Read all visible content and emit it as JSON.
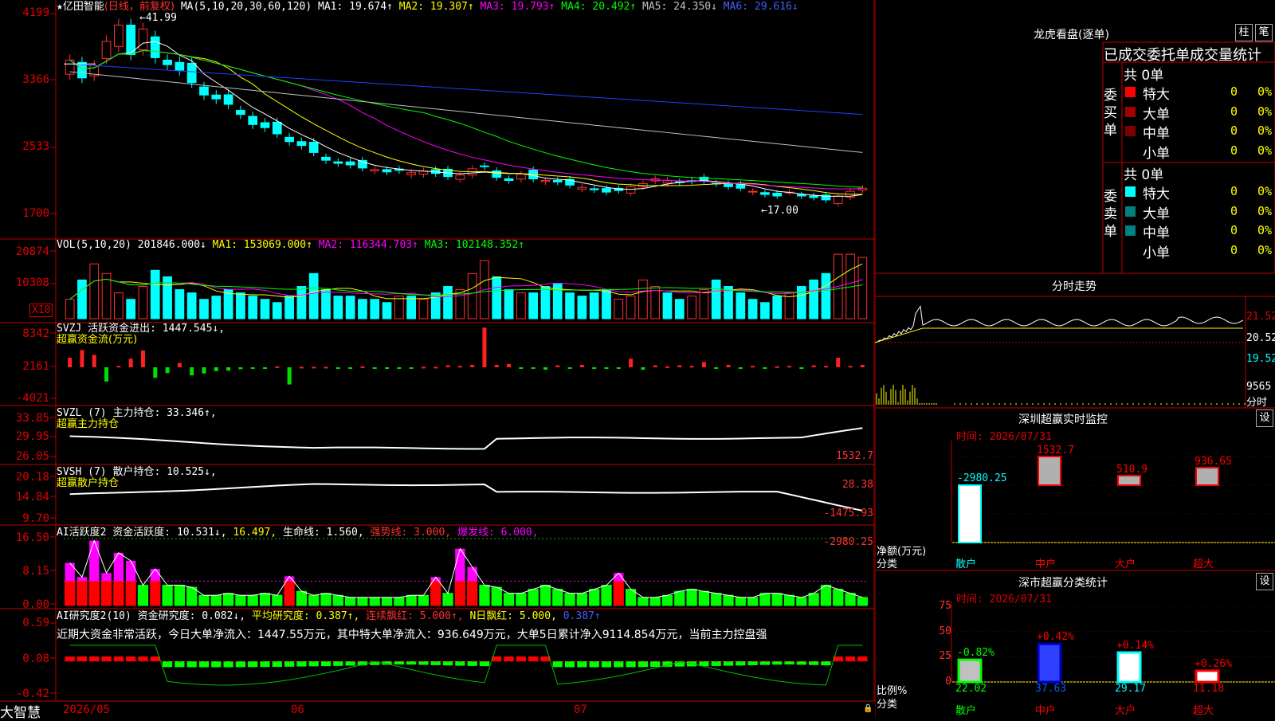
{
  "stock": {
    "star": "★",
    "name": "亿田智能",
    "period": "(日线，前复权)"
  },
  "main": {
    "ma_header": "MA(5,10,20,30,60,120)",
    "ma_items": [
      {
        "label": "MA1: 19.674↑",
        "color": "#ffffff"
      },
      {
        "label": "MA2: 19.307↑",
        "color": "#ffff00"
      },
      {
        "label": "MA3: 19.793↑",
        "color": "#ff00ff"
      },
      {
        "label": "MA4: 20.492↑",
        "color": "#00ff00"
      },
      {
        "label": "MA5: 24.350↓",
        "color": "#c0c0c0"
      },
      {
        "label": "MA6: 29.616↓",
        "color": "#4060ff"
      }
    ],
    "yaxis": [
      "4199",
      "3366",
      "2533",
      "1700"
    ],
    "high_label": "41.99",
    "low_label": "17.00"
  },
  "vol": {
    "header": "VOL(5,10,20)",
    "items": [
      {
        "label": "201846.000↓",
        "color": "#ffffff"
      },
      {
        "label": "MA1: 153069.000↑",
        "color": "#ffff00"
      },
      {
        "label": "MA2: 116344.703↑",
        "color": "#ff00ff"
      },
      {
        "label": "MA3: 102148.352↑",
        "color": "#00ff00"
      }
    ],
    "yaxis": [
      "20874",
      "10308"
    ],
    "unit": "X10"
  },
  "svzj": {
    "header": "SVZJ  活跃资金进出: 1447.545↓,",
    "sub": "超赢资金流(万元)",
    "yaxis": [
      "8342",
      "2161",
      "-4021"
    ]
  },
  "svzl": {
    "header": "SVZL (7) 主力持仓: 33.346↑,",
    "sub": "超赢主力持仓",
    "yaxis": [
      "33.85",
      "29.95",
      "26.05"
    ]
  },
  "svsh": {
    "header": "SVSH (7) 散户持仓: 10.525↓,",
    "sub": "超赢散户持仓",
    "yaxis": [
      "20.18",
      "14.84",
      "9.70"
    ]
  },
  "ai1": {
    "items": [
      {
        "label": "AI活跃度2 资金活跃度: 10.531↓,",
        "color": "#ffffff"
      },
      {
        "label": "16.497,",
        "color": "#ffff00"
      },
      {
        "label": "生命线: 1.560,",
        "color": "#ffffff"
      },
      {
        "label": "强势线: 3.000,",
        "color": "#ff3030"
      },
      {
        "label": "爆发线: 6.000,",
        "color": "#ff00ff"
      }
    ],
    "yaxis": [
      "16.50",
      "8.15",
      "0.00"
    ]
  },
  "ai2": {
    "items": [
      {
        "label": "AI研究度2(10) 资金研究度: 0.082↓,",
        "color": "#ffffff"
      },
      {
        "label": "平均研究度: 0.387↑,",
        "color": "#ffff00"
      },
      {
        "label": "连续飘红: 5.000↑,",
        "color": "#ff3030"
      },
      {
        "label": "N日飘红: 5.000,",
        "color": "#ffff00"
      },
      {
        "label": "0.387↑",
        "color": "#4060ff"
      }
    ],
    "desc": "近期大资金非常活跃，今日大单净流入：1447.55万元，其中特大单净流入：936.649万元，大单5日累计净入9114.854万元，当前主力控盘强",
    "yaxis": [
      "0.59",
      "0.08",
      "-0.42"
    ]
  },
  "bottom": {
    "brand": "大智慧",
    "dates": [
      "2026/05",
      "06",
      "07"
    ]
  },
  "lhb": {
    "title": "龙虎看盘(逐单)",
    "btn1": "柱",
    "btn2": "笔",
    "subtitle": "已成交委托单成交量统计",
    "buy": {
      "label": "委买单",
      "total": "共 0单",
      "rows": [
        {
          "name": "特大",
          "count": "0",
          "pct": "0%",
          "color": "#ff0000"
        },
        {
          "name": "大单",
          "count": "0",
          "pct": "0%",
          "color": "#a00000"
        },
        {
          "name": "中单",
          "count": "0",
          "pct": "0%",
          "color": "#800000"
        },
        {
          "name": "小单",
          "count": "0",
          "pct": "0%",
          "color": "#000000"
        }
      ]
    },
    "sell": {
      "label": "委卖单",
      "total": "共 0单",
      "rows": [
        {
          "name": "特大",
          "count": "0",
          "pct": "0%",
          "color": "#00ffff"
        },
        {
          "name": "大单",
          "count": "0",
          "pct": "0%",
          "color": "#008080"
        },
        {
          "name": "中单",
          "count": "0",
          "pct": "0%",
          "color": "#008080"
        },
        {
          "name": "小单",
          "count": "0",
          "pct": "0%",
          "color": "#000000"
        }
      ]
    }
  },
  "intraday": {
    "title": "分时走势",
    "yaxis": [
      "21.52",
      "20.52",
      "19.52"
    ],
    "vol": "9565",
    "vol_unit": "分时"
  },
  "monitor": {
    "title": "深圳超赢实时监控",
    "btn": "设",
    "time": "时间: 2026/07/31",
    "yaxis": [
      "1532.7",
      "28.38",
      "-1475.93",
      "-2980.25"
    ],
    "unit1": "净额(万元)",
    "unit2": "分类",
    "bars": [
      {
        "cat": "散户",
        "value": -2980.25,
        "label": "-2980.25"
      },
      {
        "cat": "中户",
        "value": 1532.7,
        "label": "1532.7"
      },
      {
        "cat": "大户",
        "value": 510.9,
        "label": "510.9"
      },
      {
        "cat": "超大",
        "value": 936.65,
        "label": "936.65"
      }
    ]
  },
  "classify": {
    "title": "深市超赢分类统计",
    "btn": "设",
    "time": "时间: 2026/07/31",
    "yaxis": [
      "75",
      "50",
      "25",
      "0"
    ],
    "unit1": "比例%",
    "unit2": "分类",
    "bars": [
      {
        "cat": "散户",
        "value": 22.02,
        "change": "-0.82%"
      },
      {
        "cat": "中户",
        "value": 37.63,
        "change": "+0.42%"
      },
      {
        "cat": "大户",
        "value": 29.17,
        "change": "+0.14%"
      },
      {
        "cat": "超大",
        "value": 11.18,
        "change": "+0.26%"
      }
    ]
  },
  "chart_data": {
    "type": "candlestick",
    "series_closes": [
      36.5,
      34.2,
      35.8,
      38.9,
      41.0,
      37.2,
      40.5,
      36.8,
      35.9,
      35.2,
      33.6,
      32.0,
      31.5,
      30.8,
      29.5,
      28.2,
      27.8,
      27.0,
      26.0,
      25.5,
      24.6,
      23.6,
      23.2,
      23.0,
      22.6,
      22.4,
      22.1,
      22.3,
      22.0,
      22.2,
      21.9,
      21.5,
      21.7,
      22.5,
      22.8,
      21.4,
      21.0,
      21.8,
      21.2,
      21.0,
      20.8,
      20.4,
      20.1,
      19.8,
      19.5,
      19.7,
      20.2,
      20.6,
      21.2,
      21.0,
      20.8,
      20.9,
      21.0,
      20.6,
      20.2,
      20.0,
      19.6,
      19.2,
      19.0,
      19.5,
      19.0,
      18.8,
      18.5,
      19.0,
      19.6,
      20.0
    ],
    "volume": [
      6,
      12,
      17,
      14,
      8,
      6,
      10,
      15,
      13,
      9,
      8,
      6,
      7,
      9,
      8,
      7,
      6,
      5,
      7,
      10,
      14,
      9,
      7,
      7,
      6,
      6,
      5,
      7,
      7,
      6,
      8,
      10,
      9,
      14,
      18,
      13,
      9,
      8,
      8,
      10,
      11,
      8,
      7,
      8,
      9,
      6,
      7,
      12,
      10,
      8,
      6,
      7,
      9,
      12,
      10,
      8,
      6,
      5,
      7,
      8,
      10,
      12,
      14,
      20,
      20,
      19
    ],
    "svzj": [
      2,
      3.6,
      2.6,
      -3,
      0.3,
      1.8,
      3.5,
      -2.2,
      -1.2,
      0.9,
      -1.7,
      -1.3,
      -0.8,
      -0.7,
      -0.4,
      -0.3,
      -0.3,
      0.2,
      -3.6,
      0.1,
      0.1,
      0.1,
      -0.3,
      -0.2,
      0.2,
      -0.2,
      -0.2,
      -0.2,
      -0.2,
      0.1,
      0.1,
      0.4,
      0.3,
      0.5,
      8.3,
      0.5,
      0.7,
      -0.3,
      -0.3,
      -0.5,
      0.4,
      -0.2,
      0.5,
      -0.3,
      -0.2,
      -0.2,
      1.8,
      -0.5,
      0.4,
      0.2,
      0.4,
      0.3,
      1.1,
      -0.2,
      0.5,
      -0.3,
      0.3,
      -0.2,
      0.2,
      0.3,
      -0.3,
      0.4,
      0.3,
      2,
      0.3,
      0.5,
      2,
      0.8
    ],
    "ai1": [
      10.5,
      7,
      16,
      8,
      13,
      11,
      5,
      9,
      5,
      5,
      4.5,
      2.5,
      2.5,
      3,
      2.5,
      2.5,
      3,
      2.5,
      7.2,
      3.5,
      2.5,
      3,
      2.5,
      2,
      2,
      2,
      2,
      2,
      2.5,
      2.5,
      7,
      3,
      14,
      9.5,
      5,
      4.5,
      3,
      3,
      4,
      5,
      4,
      3,
      3,
      4,
      5,
      8,
      4,
      2,
      2,
      2.5,
      3.5,
      4,
      3.5,
      3,
      2.5,
      2,
      2,
      3,
      3,
      2.5,
      2,
      3,
      5,
      4,
      3,
      2,
      3,
      12,
      11,
      10.5
    ]
  }
}
